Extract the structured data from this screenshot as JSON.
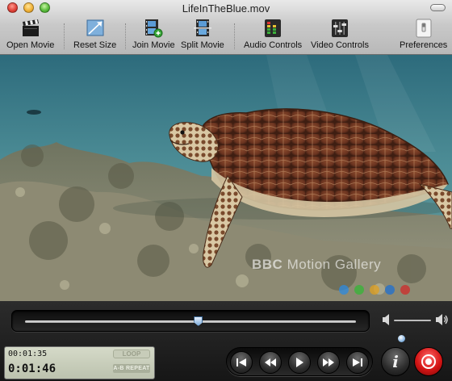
{
  "window": {
    "title": "LifeInTheBlue.mov"
  },
  "toolbar": {
    "items": [
      {
        "label": "Open Movie",
        "icon": "clapperboard-icon"
      },
      {
        "label": "Reset Size",
        "icon": "resize-icon"
      },
      {
        "label": "Join Movie",
        "icon": "film-join-icon"
      },
      {
        "label": "Split Movie",
        "icon": "film-split-icon"
      },
      {
        "label": "Audio Controls",
        "icon": "audio-levels-icon"
      },
      {
        "label": "Video Controls",
        "icon": "video-sliders-icon"
      },
      {
        "label": "Preferences",
        "icon": "preferences-switch-icon"
      }
    ]
  },
  "video": {
    "watermark_brand": "BBC",
    "watermark_text": "Motion Gallery",
    "watermark_dot_colors": [
      "#2c8ae0",
      "#35b535",
      "#e0a020",
      "#1f6fd0",
      "#d02a2a"
    ]
  },
  "playback": {
    "position_fraction": 0.52,
    "volume_fraction": 0.2
  },
  "lcd": {
    "current_time": "00:01:35",
    "total_time": "0:01:46",
    "loop_label": "LOOP",
    "ab_repeat_label": "A-B REPEAT"
  },
  "colors": {
    "accent_blue": "#7aa9d8",
    "record_red": "#d41515",
    "lcd_green": "#c9cebb"
  }
}
